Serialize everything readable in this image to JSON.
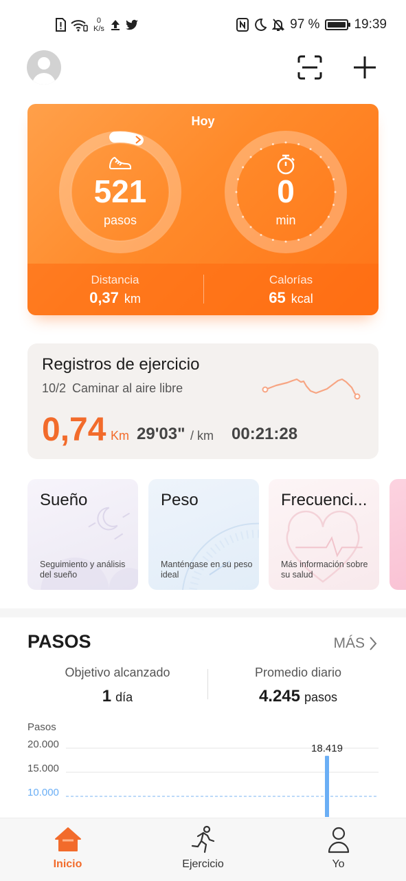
{
  "status_bar": {
    "speed_value": "0",
    "speed_unit": "K/s",
    "battery": "97 %",
    "battery_level": 0.97,
    "time": "19:39"
  },
  "header": {
    "avatar_icon": "person-icon",
    "scan_icon": "scan-icon",
    "add_icon": "plus-icon"
  },
  "today": {
    "title": "Hoy",
    "steps_value": "521",
    "steps_unit": "pasos",
    "minutes_value": "0",
    "minutes_unit": "min",
    "distance_label": "Distancia",
    "distance_value": "0,37",
    "distance_unit": "km",
    "calories_label": "Calorías",
    "calories_value": "65",
    "calories_unit": "kcal",
    "accent_color": "#ff8a2a"
  },
  "exercise": {
    "title": "Registros de ejercicio",
    "date": "10/2",
    "activity": "Caminar al aire libre",
    "distance": "0,74",
    "distance_unit": "Km",
    "pace": "29'03\"",
    "pace_unit": "/ km",
    "duration": "00:21:28",
    "accent_color": "#f26b2b"
  },
  "tiles": [
    {
      "title": "Sueño",
      "desc": "Seguimiento y análisis del sueño"
    },
    {
      "title": "Peso",
      "desc": "Manténgase en su peso ideal"
    },
    {
      "title": "Frecuenci...",
      "desc": "Más información sobre su salud"
    }
  ],
  "steps_section": {
    "title": "PASOS",
    "more_label": "MÁS",
    "goal_label": "Objetivo alcanzado",
    "goal_value": "1",
    "goal_unit": "día",
    "avg_label": "Promedio diario",
    "avg_value": "4.245",
    "avg_unit": "pasos"
  },
  "chart_data": {
    "type": "bar",
    "ylabel": "Pasos",
    "y_ticks": [
      "20.000",
      "15.000",
      "10.000"
    ],
    "goal_line": 10000,
    "ylim": [
      0,
      20000
    ],
    "values": [
      0,
      0,
      0,
      0,
      0,
      1500,
      1500,
      18419
    ],
    "value_label": "18.419",
    "bar_color": "#6aaef5"
  },
  "bottom_nav": [
    {
      "label": "Inicio",
      "icon": "home-icon",
      "active": true
    },
    {
      "label": "Ejercicio",
      "icon": "running-icon",
      "active": false
    },
    {
      "label": "Yo",
      "icon": "profile-icon",
      "active": false
    }
  ]
}
